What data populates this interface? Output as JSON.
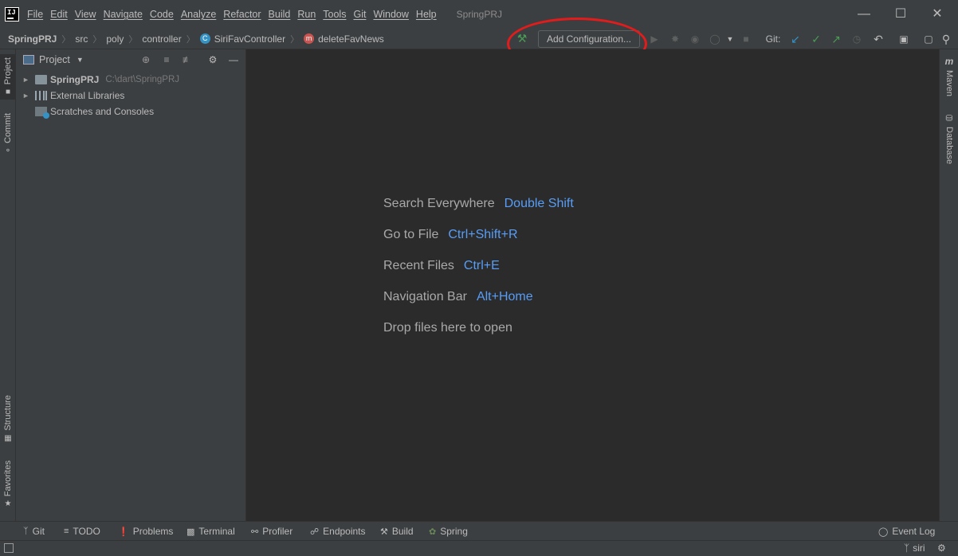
{
  "menubar": {
    "logo_text": "IJ",
    "items": [
      "File",
      "Edit",
      "View",
      "Navigate",
      "Code",
      "Analyze",
      "Refactor",
      "Build",
      "Run",
      "Tools",
      "Git",
      "Window",
      "Help"
    ],
    "project_title": "SpringPRJ"
  },
  "breadcrumbs": {
    "project": "SpringPRJ",
    "src": "src",
    "poly": "poly",
    "controller": "controller",
    "class_icon": "C",
    "class": "SiriFavController",
    "method_icon": "m",
    "method": "deleteFavNews"
  },
  "toolbar": {
    "add_configuration": "Add Configuration...",
    "git_label": "Git:"
  },
  "left_strip": {
    "project": "Project",
    "commit": "Commit",
    "structure": "Structure",
    "favorites": "Favorites"
  },
  "project_panel": {
    "view_label": "Project",
    "tree": [
      {
        "label": "SpringPRJ",
        "path": "C:\\dart\\SpringPRJ",
        "icon": "folder-icon"
      },
      {
        "label": "External Libraries",
        "icon": "library-icon"
      },
      {
        "label": "Scratches and Consoles",
        "icon": "scratch-icon"
      }
    ]
  },
  "editor": {
    "hints": [
      {
        "label": "Search Everywhere",
        "key": "Double Shift"
      },
      {
        "label": "Go to File",
        "key": "Ctrl+Shift+R"
      },
      {
        "label": "Recent Files",
        "key": "Ctrl+E"
      },
      {
        "label": "Navigation Bar",
        "key": "Alt+Home"
      },
      {
        "label": "Drop files here to open",
        "key": ""
      }
    ]
  },
  "right_strip": {
    "maven_icon": "m",
    "maven": "Maven",
    "database": "Database"
  },
  "bottom_bar": {
    "git": "Git",
    "todo": "TODO",
    "problems": "Problems",
    "terminal": "Terminal",
    "profiler": "Profiler",
    "endpoints": "Endpoints",
    "build": "Build",
    "spring": "Spring",
    "event_log": "Event Log"
  },
  "status_bar": {
    "branch": "siri"
  },
  "colors": {
    "accent_link": "#589df6",
    "highlight": "#e31b1b",
    "git_update": "#3592c4",
    "git_commit": "#499c54"
  }
}
